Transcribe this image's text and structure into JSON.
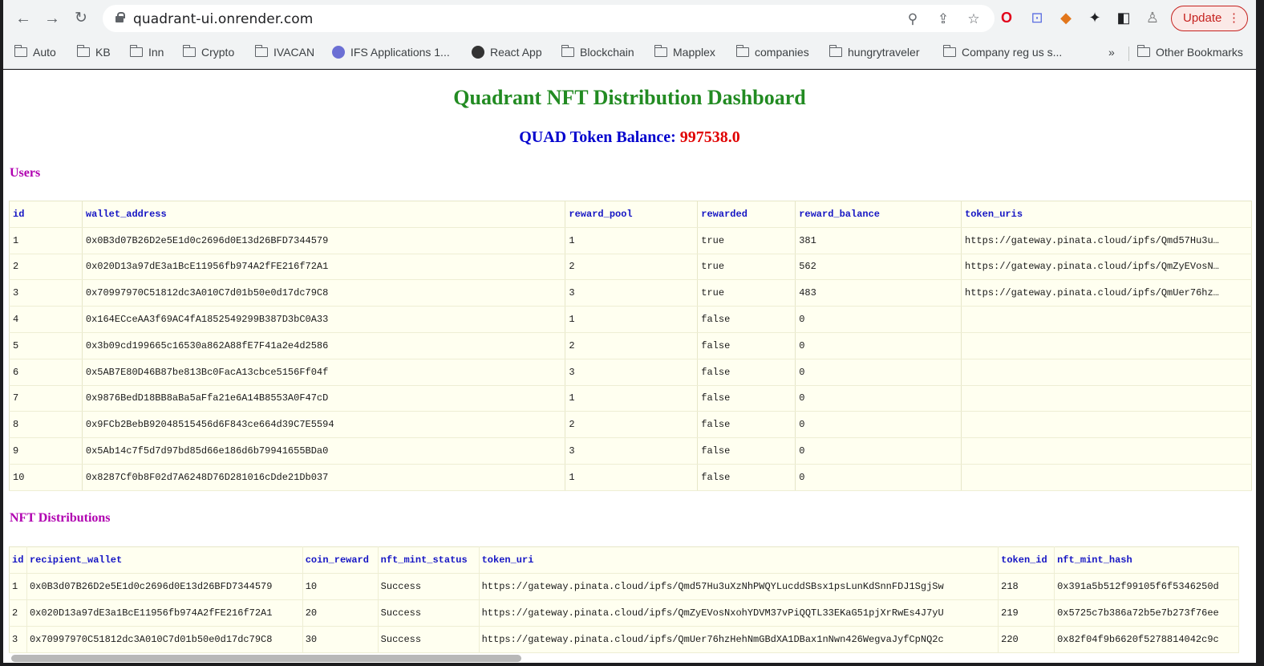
{
  "browser": {
    "url": "quadrant-ui.onrender.com",
    "update_label": "Update",
    "bookmarks": [
      "Auto",
      "KB",
      "Inn",
      "Crypto",
      "IVACAN",
      "IFS Applications 1...",
      "React App",
      "Blockchain",
      "Mapplex",
      "companies",
      "hungrytraveler",
      "Company reg us s..."
    ],
    "overflow_label": "»",
    "other_bookmarks": "Other Bookmarks"
  },
  "page": {
    "title": "Quadrant NFT Distribution Dashboard",
    "balance_label": "QUAD Token Balance:",
    "balance_value": "997538.0",
    "users_title": "Users",
    "nft_title": "NFT Distributions"
  },
  "users": {
    "columns": [
      "id",
      "wallet_address",
      "reward_pool",
      "rewarded",
      "reward_balance",
      "token_uris"
    ],
    "rows": [
      [
        "1",
        "0x0B3d07B26D2e5E1d0c2696d0E13d26BFD7344579",
        "1",
        "true",
        "381",
        "https://gateway.pinata.cloud/ipfs/Qmd57Hu3u…"
      ],
      [
        "2",
        "0x020D13a97dE3a1BcE11956fb974A2fFE216f72A1",
        "2",
        "true",
        "562",
        "https://gateway.pinata.cloud/ipfs/QmZyEVosN…"
      ],
      [
        "3",
        "0x70997970C51812dc3A010C7d01b50e0d17dc79C8",
        "3",
        "true",
        "483",
        "https://gateway.pinata.cloud/ipfs/QmUer76hz…"
      ],
      [
        "4",
        "0x164ECceAA3f69AC4fA1852549299B387D3bC0A33",
        "1",
        "false",
        "0",
        ""
      ],
      [
        "5",
        "0x3b09cd199665c16530a862A88fE7F41a2e4d2586",
        "2",
        "false",
        "0",
        ""
      ],
      [
        "6",
        "0x5AB7E80D46B87be813Bc0FacA13cbce5156Ff04f",
        "3",
        "false",
        "0",
        ""
      ],
      [
        "7",
        "0x9876BedD18BB8aBa5aFfa21e6A14B8553A0F47cD",
        "1",
        "false",
        "0",
        ""
      ],
      [
        "8",
        "0x9FCb2BebB92048515456d6F843ce664d39C7E5594",
        "2",
        "false",
        "0",
        ""
      ],
      [
        "9",
        "0x5Ab14c7f5d7d97bd85d66e186d6b79941655BDa0",
        "3",
        "false",
        "0",
        ""
      ],
      [
        "10",
        "0x8287Cf0b8F02d7A6248D76D281016cDde21Db037",
        "1",
        "false",
        "0",
        ""
      ]
    ]
  },
  "nft": {
    "columns": [
      "id",
      "recipient_wallet",
      "coin_reward",
      "nft_mint_status",
      "token_uri",
      "token_id",
      "nft_mint_hash"
    ],
    "rows": [
      [
        "1",
        "0x0B3d07B26D2e5E1d0c2696d0E13d26BFD7344579",
        "10",
        "Success",
        "https://gateway.pinata.cloud/ipfs/Qmd57Hu3uXzNhPWQYLucddSBsx1psLunKdSnnFDJ1SgjSw",
        "218",
        "0x391a5b512f99105f6f5346250d"
      ],
      [
        "2",
        "0x020D13a97dE3a1BcE11956fb974A2fFE216f72A1",
        "20",
        "Success",
        "https://gateway.pinata.cloud/ipfs/QmZyEVosNxohYDVM37vPiQQTL33EKaG51pjXrRwEs4J7yU",
        "219",
        "0x5725c7b386a72b5e7b273f76ee"
      ],
      [
        "3",
        "0x70997970C51812dc3A010C7d01b50e0d17dc79C8",
        "30",
        "Success",
        "https://gateway.pinata.cloud/ipfs/QmUer76hzHehNmGBdXA1DBax1nNwn426WegvaJyfCpNQ2c",
        "220",
        "0x82f04f9b6620f5278814042c9c"
      ]
    ]
  },
  "colors": {
    "title": "#228b22",
    "balance_label": "#0000cd",
    "balance_value": "#e00000",
    "section": "#b000b0",
    "table_header": "#1515c4",
    "table_bg": "#fffff0"
  }
}
